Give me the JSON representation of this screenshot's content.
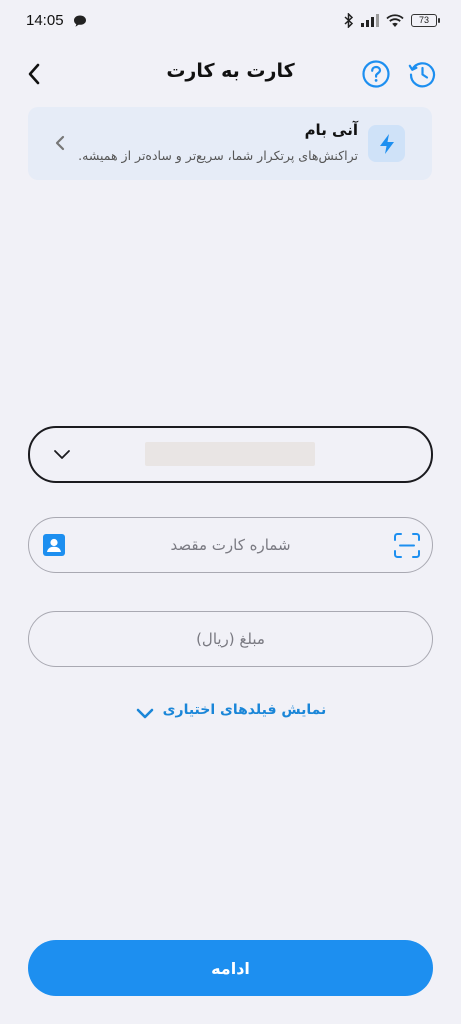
{
  "status_bar": {
    "time": "14:05",
    "battery": "73",
    "icons": [
      "chat-bubble-icon",
      "bluetooth-icon",
      "signal-icon",
      "wifi-icon",
      "battery-icon"
    ]
  },
  "header": {
    "title": "کارت به کارت",
    "back_icon": "chevron-left-icon",
    "help_icon": "help-circle-icon",
    "history_icon": "history-icon"
  },
  "promo": {
    "title": "آنی بام",
    "description": "تراکنش‌های پرتکرار شما، سریع‌تر و ساده‌تر از همیشه.",
    "icon": "lightning-icon"
  },
  "card_input": {
    "placeholder": "شماره کارت مقصد",
    "value": ""
  },
  "amount_input": {
    "placeholder": "مبلغ (ریال)",
    "value": ""
  },
  "optional_fields": {
    "label": "نمایش فیلدهای اختیاری"
  },
  "continue_button": {
    "label": "ادامه"
  },
  "colors": {
    "accent": "#1d8ff0",
    "link": "#1a86d8",
    "background": "#f1f1f7",
    "banner": "#e6ecf7"
  }
}
